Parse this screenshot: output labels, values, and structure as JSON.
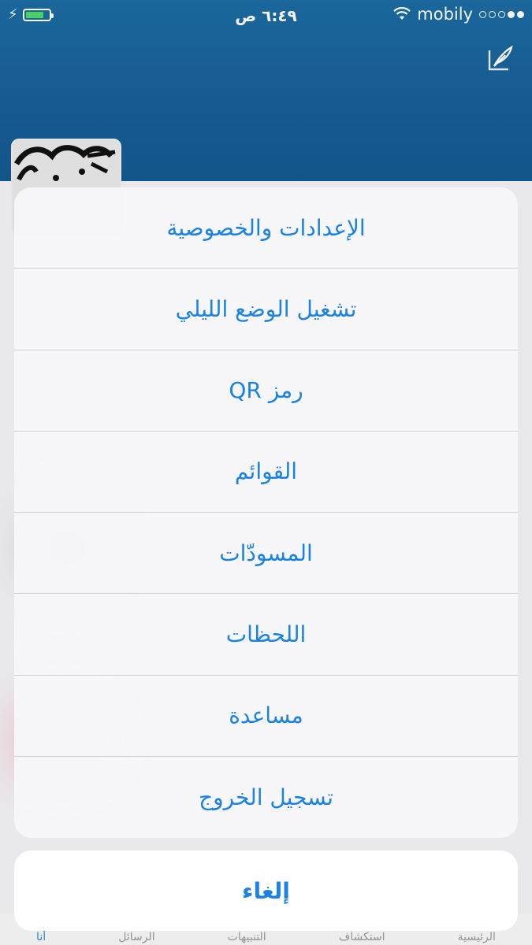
{
  "status_bar": {
    "time": "٦:٤٩ ص",
    "carrier": "mobily",
    "signal_level": 2,
    "signal_max": 5,
    "battery_level": 0.8,
    "battery_color": "#4cd964"
  },
  "header": {
    "background": "#175e96",
    "compose_icon": "compose-quill-icon"
  },
  "background_tabs": [
    "أنا",
    "الرسائل",
    "التنبيهات",
    "استكشاف",
    "الرئيسية"
  ],
  "action_sheet": {
    "items": [
      "الإعدادات والخصوصية",
      "تشغيل الوضع الليلي",
      "رمز QR",
      "القوائم",
      "المسودّات",
      "اللحظات",
      "مساعدة",
      "تسجيل الخروج"
    ],
    "cancel_label": "إلغاء",
    "accent_color": "#1a82e6"
  }
}
